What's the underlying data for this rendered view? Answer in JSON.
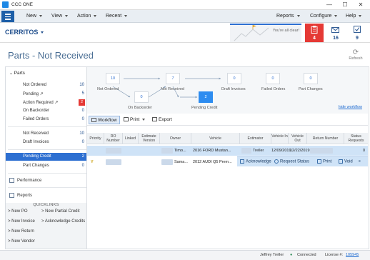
{
  "window": {
    "title": "CCC ONE",
    "controls": [
      "—",
      "☐",
      "✕"
    ]
  },
  "menu": {
    "items": [
      {
        "label": "New"
      },
      {
        "label": "View"
      },
      {
        "label": "Action"
      },
      {
        "label": "Recent"
      }
    ],
    "right_items": [
      {
        "label": "Reports"
      },
      {
        "label": "Configure"
      },
      {
        "label": "Help"
      }
    ]
  },
  "location": {
    "name": "CERRITOS",
    "notice": "You're all clear!",
    "alert_count": "4",
    "mail_count": "16",
    "task_count": "9",
    "accent_color": "#2d6fd1",
    "alert_color": "#e53935"
  },
  "page": {
    "title": "Parts - Not Received",
    "refresh_label": "Refresh"
  },
  "sidebar": {
    "section": "Parts",
    "items": [
      {
        "label": "Not Ordered",
        "count": "10"
      },
      {
        "label": "Pending ↗",
        "count": "5"
      },
      {
        "label": "Action Required ↗",
        "count": "2"
      },
      {
        "label": "On Backorder",
        "count": "0"
      },
      {
        "label": "Failed Orders",
        "count": "0"
      },
      {
        "label": "Not Received",
        "count": "10"
      },
      {
        "label": "Draft Invoices",
        "count": "0"
      },
      {
        "label": "Pending Credit",
        "count": "2"
      },
      {
        "label": "Part Changes",
        "count": "0"
      }
    ],
    "links": [
      {
        "label": "Performance",
        "icon": "chart-icon"
      },
      {
        "label": "Reports",
        "icon": "document-icon"
      }
    ],
    "quicklinks_title": "QUICKLINKS",
    "quicklinks": [
      {
        "label": "New PO"
      },
      {
        "label": "New Partial Credit"
      },
      {
        "label": "New Invoice"
      },
      {
        "label": "Acknowledge Credits"
      },
      {
        "label": "New Return"
      },
      {
        "label": "New Vendor"
      }
    ]
  },
  "workflow": {
    "nodes": [
      {
        "count": "10",
        "label": "Not Ordered"
      },
      {
        "count": "0",
        "label": "On Backorder"
      },
      {
        "count": "7",
        "label": "Not Received"
      },
      {
        "count": "2",
        "label": "Pending Credit"
      },
      {
        "count": "0",
        "label": "Draft Invoices"
      },
      {
        "count": "0",
        "label": "Failed Orders"
      },
      {
        "count": "0",
        "label": "Part Changes"
      }
    ],
    "hide_label": "hide workflow"
  },
  "toolbar": {
    "workflow": "Workflow",
    "print": "Print",
    "export": "Export"
  },
  "table": {
    "columns": [
      "Priority",
      "RO Number",
      "Linked",
      "Estimate Version",
      "Owner",
      "Vehicle",
      "Estimator",
      "Vehicle In",
      "Vehicle Out",
      "Return Number",
      "Status Requests"
    ],
    "rows": [
      {
        "priority": "",
        "owner": "Timo...",
        "vehicle": "2016 FORD Mustan...",
        "estimator": "Treller",
        "vin": "12/09/2019",
        "vout": "12/22/2019",
        "status": "0"
      },
      {
        "priority": "Y",
        "owner": "Sama...",
        "vehicle": "2012 AUDI Q5 Prem...",
        "estimator": "",
        "vin": "",
        "vout": "",
        "status": ""
      }
    ],
    "actions": [
      "Acknowledge",
      "Request Status",
      "Print",
      "Void"
    ]
  },
  "status": {
    "user": "Jeffrey Treller",
    "connection": "Connected",
    "license_label": "License #:",
    "license_number": "105945"
  }
}
